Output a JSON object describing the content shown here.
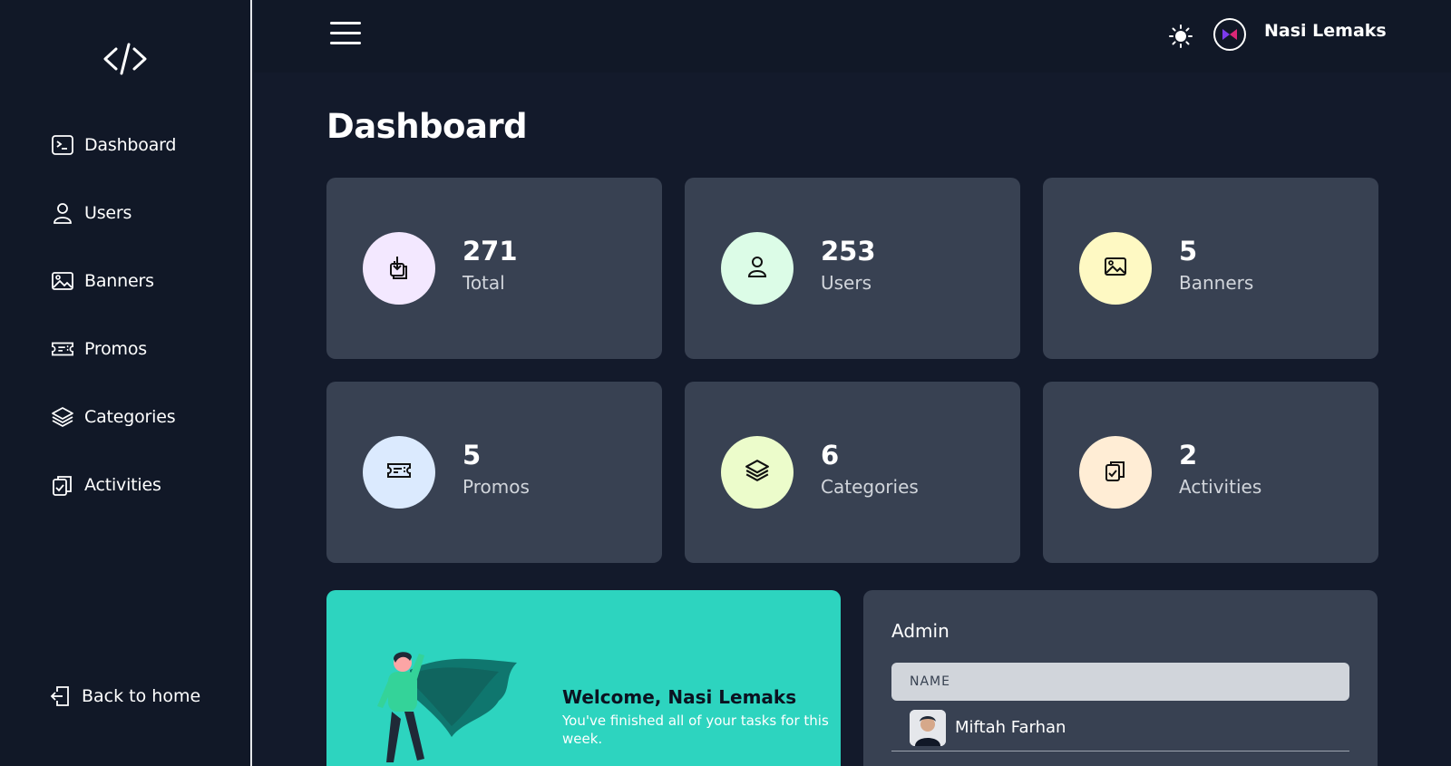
{
  "sidebar": {
    "logo_icon": "code-icon",
    "items": [
      {
        "label": "Dashboard",
        "icon": "terminal-icon"
      },
      {
        "label": "Users",
        "icon": "user-icon"
      },
      {
        "label": "Banners",
        "icon": "image-icon"
      },
      {
        "label": "Promos",
        "icon": "ticket-icon"
      },
      {
        "label": "Categories",
        "icon": "layers-icon"
      },
      {
        "label": "Activities",
        "icon": "clipboard-icon"
      }
    ],
    "back_label": "Back to home"
  },
  "header": {
    "username": "Nasi Lemaks",
    "theme_icon": "sun-icon"
  },
  "main": {
    "title": "Dashboard",
    "cards": [
      {
        "value": "271",
        "caption": "Total",
        "color": "#f3e8ff",
        "icon": "download-icon"
      },
      {
        "value": "253",
        "caption": "Users",
        "color": "#dcfce7",
        "icon": "user-icon"
      },
      {
        "value": "5",
        "caption": "Banners",
        "color": "#fef9c3",
        "icon": "image-icon"
      },
      {
        "value": "5",
        "caption": "Promos",
        "color": "#dbeafe",
        "icon": "ticket-icon"
      },
      {
        "value": "6",
        "caption": "Categories",
        "color": "#ecfccb",
        "icon": "layers-icon"
      },
      {
        "value": "2",
        "caption": "Activities",
        "color": "#ffedd5",
        "icon": "clipboard-icon"
      }
    ],
    "welcome": {
      "title": "Welcome, Nasi Lemaks",
      "text": "You've finished all of your tasks for this week."
    },
    "admin": {
      "title": "Admin",
      "column": "NAME",
      "rows": [
        {
          "name": "Miftah Farhan"
        }
      ]
    }
  },
  "colors": {
    "background": "#131a2b",
    "sidebar": "#111827",
    "card": "#384152",
    "welcome": "#2dd4bf"
  }
}
